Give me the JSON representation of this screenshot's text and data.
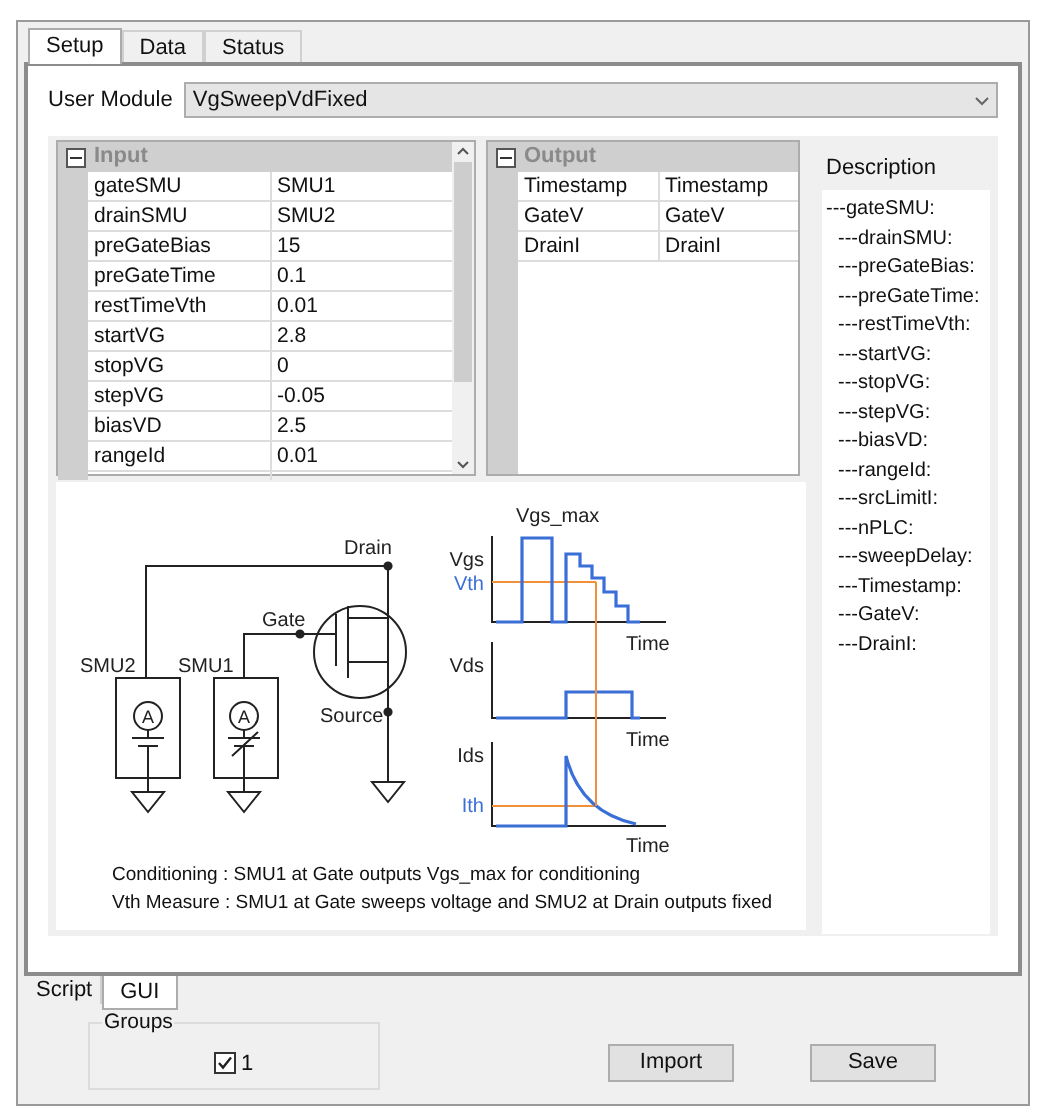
{
  "top_tabs": [
    {
      "label": "Setup",
      "selected": true
    },
    {
      "label": "Data",
      "selected": false
    },
    {
      "label": "Status",
      "selected": false
    }
  ],
  "user_module": {
    "label": "User Module",
    "value": "VgSweepVdFixed"
  },
  "input": {
    "title": "Input",
    "expanded": true,
    "rows": [
      {
        "name": "gateSMU",
        "value": "SMU1"
      },
      {
        "name": "drainSMU",
        "value": "SMU2"
      },
      {
        "name": "preGateBias",
        "value": "15"
      },
      {
        "name": "preGateTime",
        "value": "0.1"
      },
      {
        "name": "restTimeVth",
        "value": "0.01"
      },
      {
        "name": "startVG",
        "value": "2.8"
      },
      {
        "name": "stopVG",
        "value": "0"
      },
      {
        "name": "stepVG",
        "value": "-0.05"
      },
      {
        "name": "biasVD",
        "value": "2.5"
      },
      {
        "name": "rangeId",
        "value": "0.01"
      }
    ]
  },
  "output": {
    "title": "Output",
    "expanded": true,
    "rows": [
      {
        "name": "Timestamp",
        "value": "Timestamp"
      },
      {
        "name": "GateV",
        "value": "GateV"
      },
      {
        "name": "DrainI",
        "value": "DrainI"
      }
    ]
  },
  "description": {
    "title": "Description",
    "items": [
      {
        "text": "---gateSMU:",
        "children": [
          {
            "text": "---drainSMU:"
          },
          {
            "text": "---preGateBias:"
          },
          {
            "text": "---preGateTime:"
          },
          {
            "text": "---restTimeVth:"
          },
          {
            "text": "---startVG:"
          },
          {
            "text": "---stopVG:"
          },
          {
            "text": "---stepVG:"
          },
          {
            "text": "---biasVD:"
          },
          {
            "text": "---rangeId:"
          },
          {
            "text": "---srcLimitI:"
          },
          {
            "text": "---nPLC:"
          },
          {
            "text": "---sweepDelay:"
          },
          {
            "text": "---Timestamp:"
          },
          {
            "text": "---GateV:"
          },
          {
            "text": "---DrainI:"
          }
        ]
      }
    ]
  },
  "diagram": {
    "labels": [
      "Drain",
      "Gate",
      "Source",
      "SMU2",
      "SMU1",
      "A",
      "A",
      "Vgs_max",
      "Vgs",
      "Vth",
      "Time",
      "Vds",
      "Time",
      "Ids",
      "Ith",
      "Time"
    ],
    "notes": [
      "Conditioning : SMU1 at Gate outputs Vgs_max for conditioning",
      "Vth Measure : SMU1 at Gate sweeps voltage and SMU2 at Drain outputs fixed"
    ]
  },
  "bottom_tabs": [
    {
      "label": "Script",
      "selected": false
    },
    {
      "label": "GUI",
      "selected": true
    }
  ],
  "groups": {
    "title": "Groups",
    "items": [
      {
        "label": "1",
        "checked": true
      }
    ]
  },
  "buttons": [
    "Import",
    "Save"
  ]
}
